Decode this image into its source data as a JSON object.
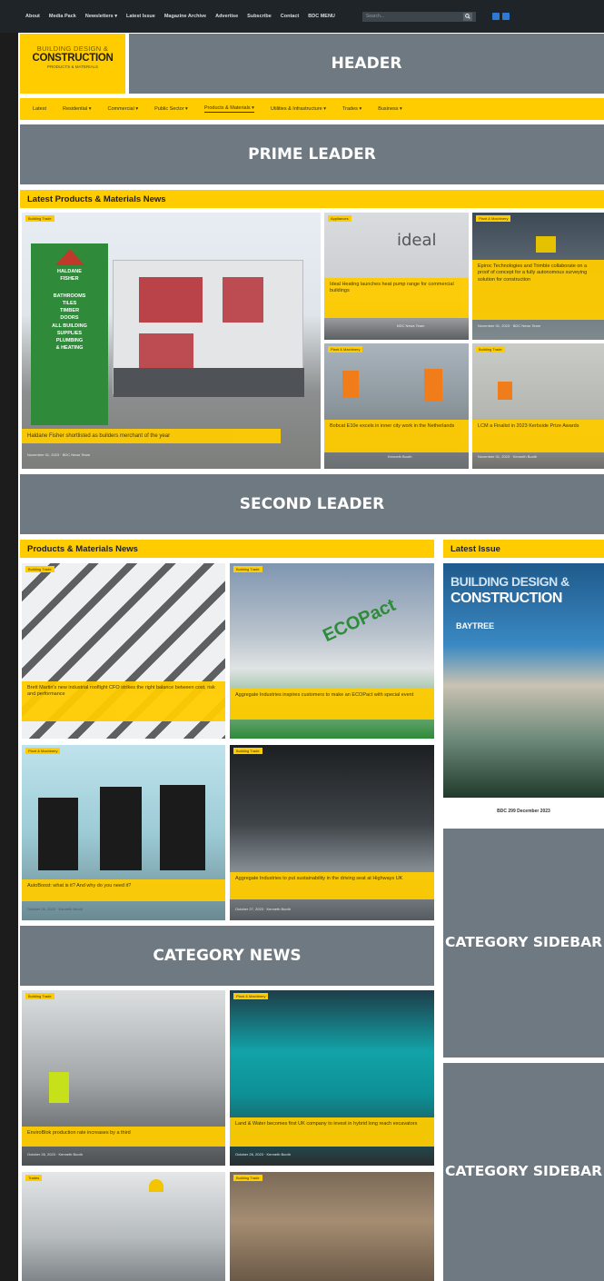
{
  "topbar": {
    "links": [
      "About",
      "Media Pack",
      "Newsletters ▾",
      "Latest Issue",
      "Magazine Archive",
      "Advertise",
      "Subscribe",
      "Contact",
      "BDC MENU"
    ],
    "search_placeholder": "Search..."
  },
  "logo": {
    "line1": "BUILDING DESIGN &",
    "line2": "CONSTRUCTION",
    "line3": "PRODUCTS & MATERIALS"
  },
  "header_placeholder": "HEADER",
  "nav": {
    "items": [
      "Latest",
      "Residential ▾",
      "Commercial ▾",
      "Public Sector ▾",
      "Products & Materials ▾",
      "Utilities & Infrastructure ▾",
      "Trades ▾",
      "Business ▾"
    ],
    "active_index": 4
  },
  "prime_leader": "PRIME LEADER",
  "latest_section": {
    "title": "Latest Products & Materials News",
    "feature": {
      "tag": "Building Trade",
      "caption": "Haldane Fisher shortlisted as builders merchant of the year",
      "meta": "November 01, 2023  ·  BDC News Team",
      "sign": [
        "HALDANE",
        "FISHER",
        "BATHROOMS",
        "TILES",
        "TIMBER",
        "DOORS",
        "ALL BUILDING",
        "SUPPLIES",
        "PLUMBING",
        "& HEATING"
      ]
    },
    "tiles": [
      {
        "tag": "Appliances",
        "caption": "Ideal Heating launches heat pump range for commercial buildings",
        "meta": "BDC News Team",
        "brand": "ideal"
      },
      {
        "tag": "Plant & Machinery",
        "caption": "Epiroc Technologies and Trimble collaborate on a proof of concept for a fully autonomous surveying solution for construction",
        "meta": "November 01, 2023  ·  BDC News Team"
      },
      {
        "tag": "Plant & Machinery",
        "caption": "Bobcat E10e excels in inner city work in the Netherlands",
        "meta": "Kenneth Booth"
      },
      {
        "tag": "Building Trade",
        "caption": "LCM a Finalist in 2023 Kerbside Prize Awards",
        "meta": "November 01, 2023  ·  Kenneth Booth"
      }
    ]
  },
  "second_leader": "SECOND LEADER",
  "pm_section": {
    "title": "Products & Materials News",
    "tiles": [
      {
        "tag": "Building Trade",
        "caption": "Brett Martin's new industrial rooflight CFO strikes the right balance between cost, risk and performance",
        "meta": ""
      },
      {
        "tag": "Building Trade",
        "caption": "Aggregate Industries inspires customers to make an ECOPact with special event",
        "meta": "",
        "brand": "ECOPact"
      },
      {
        "tag": "Plant & Machinery",
        "caption": "AutoBoost: what is it? And why do you need it?",
        "meta": "October 26, 2023  ·  Kenneth Booth"
      },
      {
        "tag": "Building Trade",
        "caption": "Aggregate Industries to put sustainability in the driving seat at Highways UK",
        "meta": "October 27, 2023  ·  Kenneth Booth"
      }
    ]
  },
  "latest_issue": {
    "title": "Latest Issue",
    "cover_line1": "BUILDING DESIGN &",
    "cover_line2": "CONSTRUCTION",
    "cover_brand": "BAYTREE",
    "label": "BDC 299 December 2023"
  },
  "category_news": "CATEGORY NEWS",
  "category_sidebar": "CATEGORY SIDEBAR",
  "cat_tiles": [
    {
      "tag": "Building Trade",
      "caption": "EnviroBlok production rate increases by a third",
      "meta": "October 26, 2023  ·  Kenneth Booth"
    },
    {
      "tag": "Plant & Machinery",
      "caption": "Land & Water becomes first UK company to invest in hybrid long reach excavators",
      "meta": "October 26, 2023  ·  Kenneth Booth"
    },
    {
      "tag": "Trades",
      "caption": "",
      "meta": ""
    },
    {
      "tag": "Building Trade",
      "caption": "",
      "meta": ""
    }
  ],
  "colors": {
    "brand_yellow": "#ffcc00",
    "placeholder_grey": "#6f7981",
    "topbar_dark": "#1f2429"
  }
}
